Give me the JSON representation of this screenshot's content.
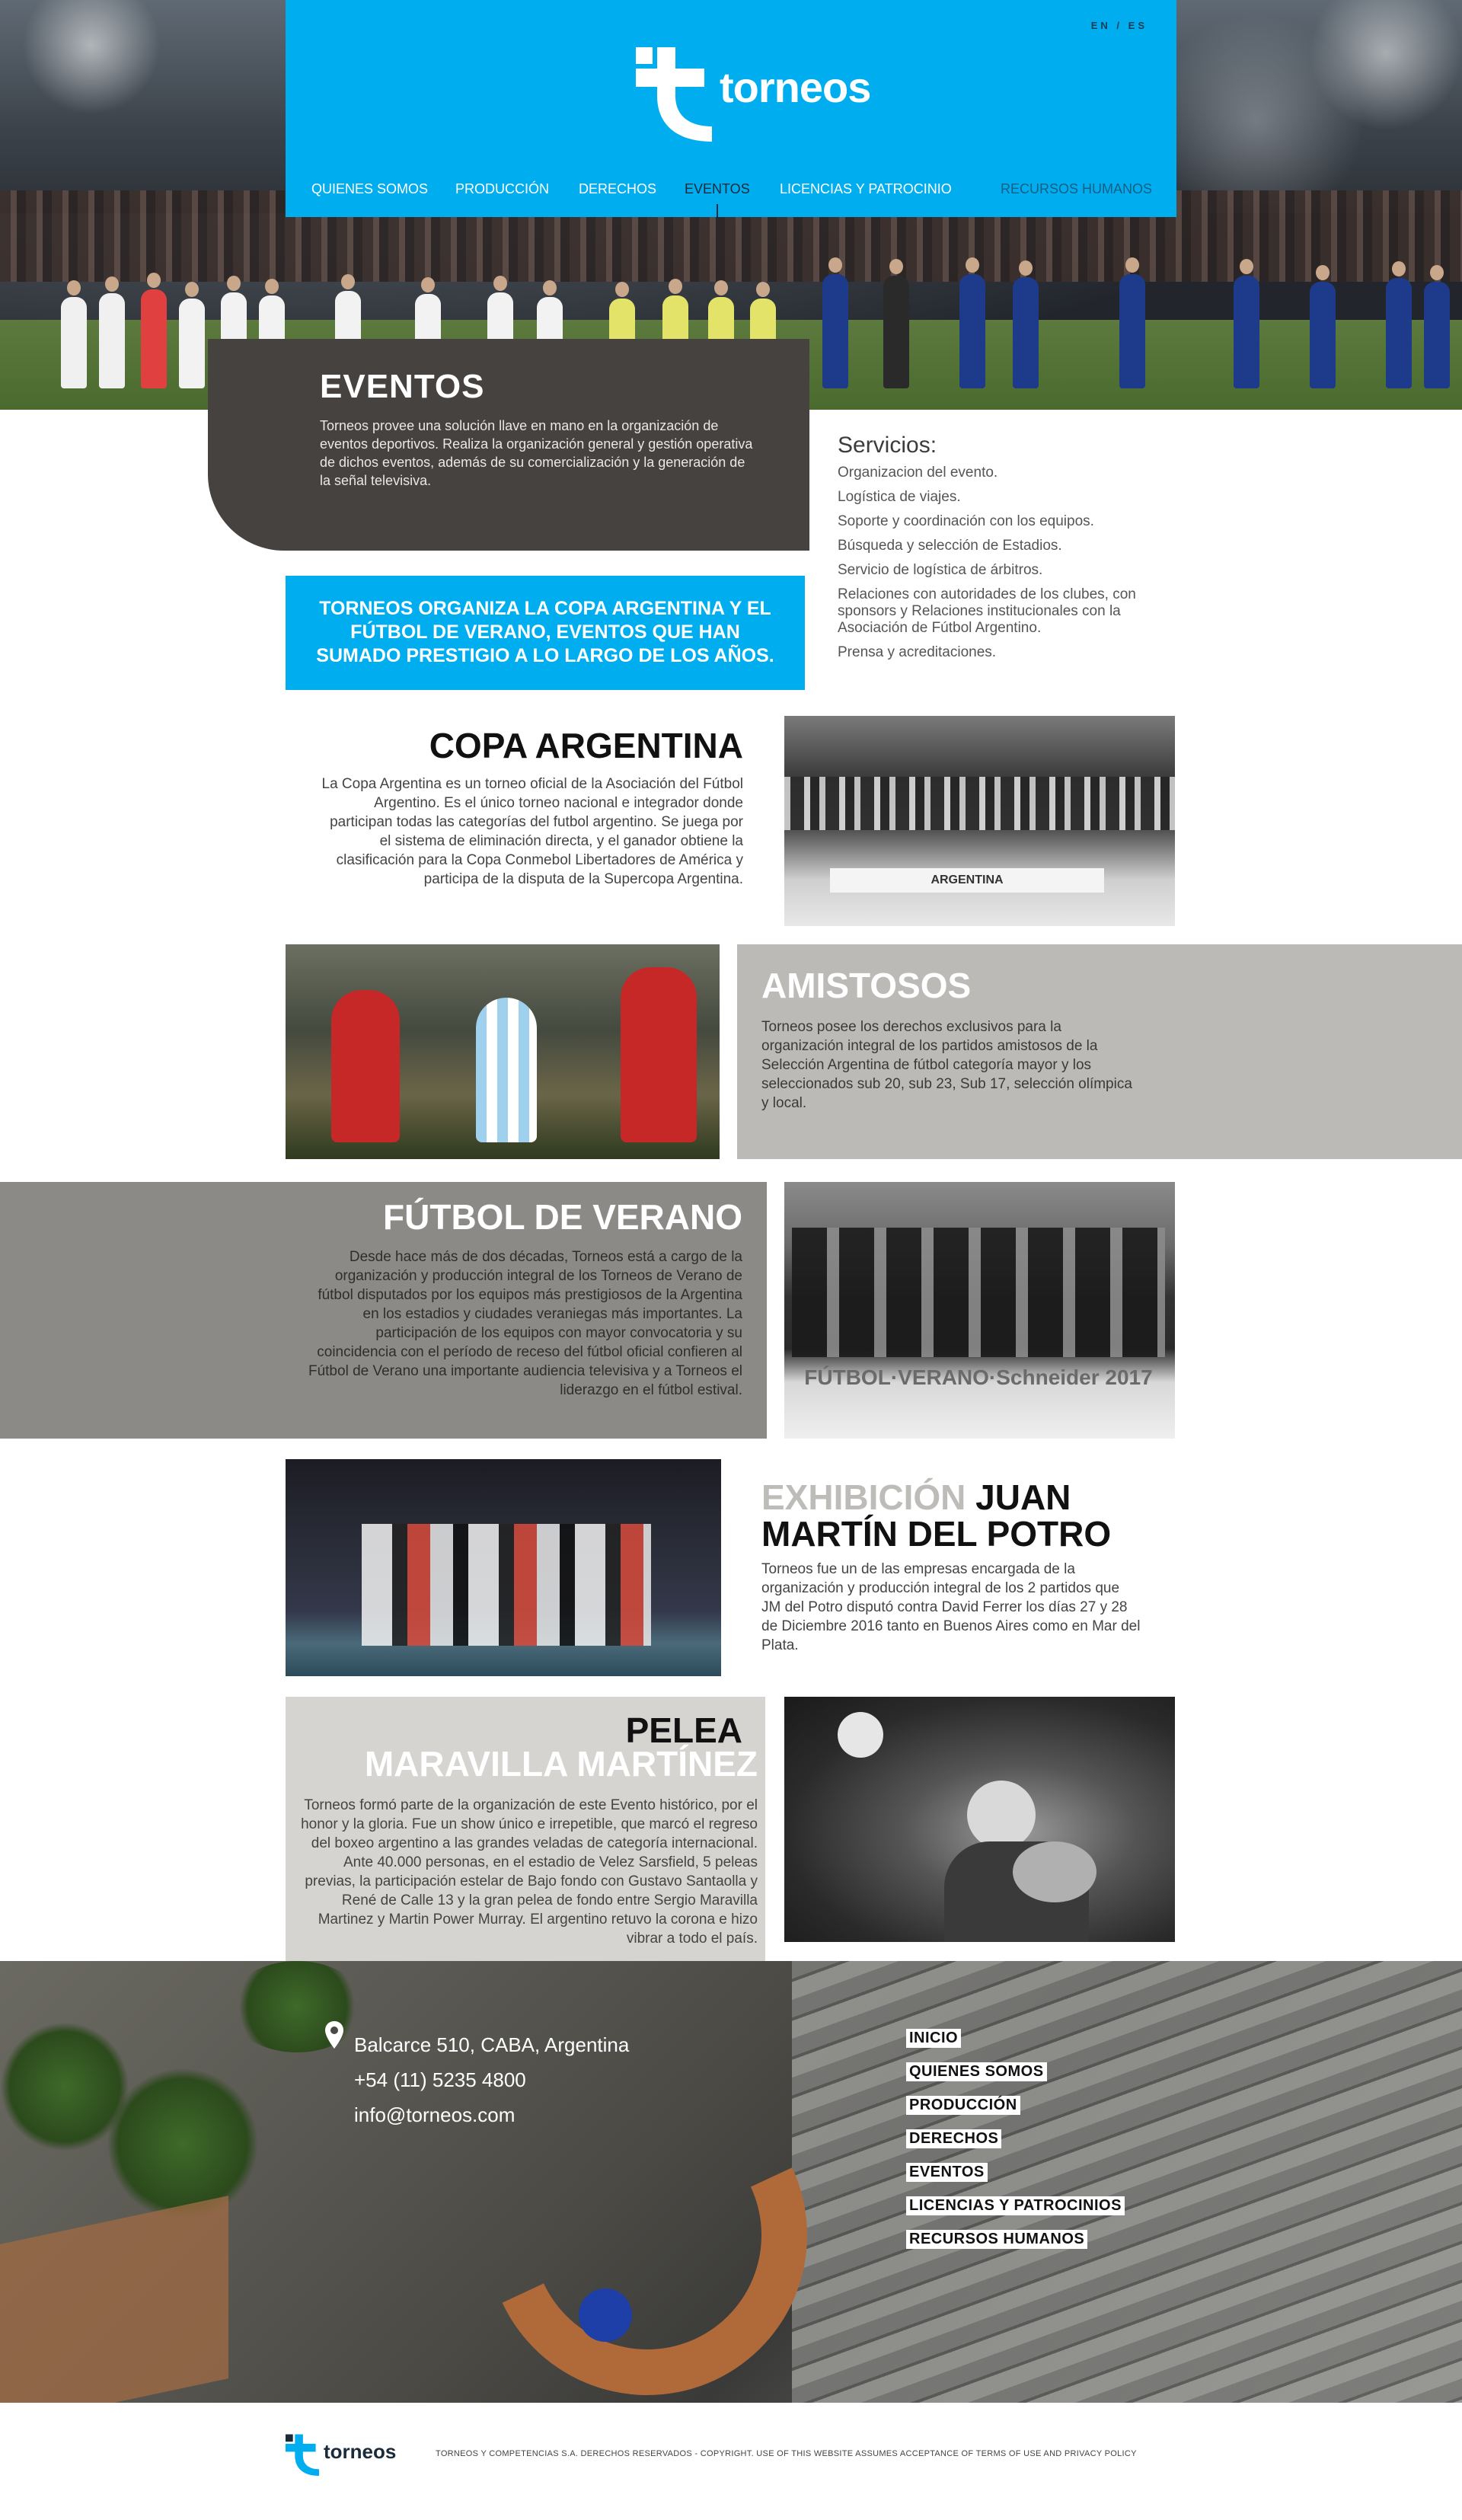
{
  "header": {
    "lang_switch": "EN / ES",
    "brand": "torneos",
    "nav": [
      {
        "label": "QUIENES SOMOS"
      },
      {
        "label": "PRODUCCIÓN"
      },
      {
        "label": "DERECHOS"
      },
      {
        "label": "EVENTOS"
      },
      {
        "label": "LICENCIAS Y PATROCINIO"
      },
      {
        "label": "RECURSOS HUMANOS"
      }
    ],
    "active_nav": "EVENTOS",
    "colors": {
      "brand_blue": "#00aeef",
      "dark": "#45423f"
    }
  },
  "intro": {
    "title": "EVENTOS",
    "text": "Torneos provee una solución llave en mano en la organización de eventos deportivos. Realiza la organización general y gestión operativa de dichos eventos, además de su comercialización y la generación de la señal televisiva."
  },
  "services": {
    "title": "Servicios:",
    "items": [
      "Organizacion del evento.",
      "Logística de viajes.",
      "Soporte y coordinación con los equipos.",
      "Búsqueda y selección de Estadios.",
      "Servicio de logística de árbitros.",
      "Relaciones con autoridades de los clubes, con sponsors y Relaciones institucionales con la Asociación de Fútbol Argentino.",
      "Prensa y acreditaciones."
    ]
  },
  "highlight": "TORNEOS ORGANIZA LA COPA ARGENTINA Y EL FÚTBOL DE VERANO, EVENTOS QUE HAN SUMADO PRESTIGIO A LO LARGO DE LOS AÑOS.",
  "sections": {
    "copa": {
      "title": "COPA ARGENTINA",
      "text": "La Copa Argentina es un torneo oficial de la  Asociación del Fútbol Argentino. Es el único torneo nacional e integrador donde participan todas las categorías del futbol argentino. Se juega por el sistema de eliminación directa, y el ganador obtiene la clasificación para la Copa Conmebol Libertadores de América y participa de la disputa de la Supercopa Argentina.",
      "photo_banner": "ARGENTINA"
    },
    "amistosos": {
      "title": "AMISTOSOS",
      "text": "Torneos posee los derechos exclusivos para la organización integral de los partidos amistosos de la Selección Argentina de fútbol categoría mayor y los seleccionados sub 20, sub 23, Sub 17, selección olímpica y local."
    },
    "verano": {
      "title": "FÚTBOL DE VERANO",
      "text": "Desde hace más de dos décadas, Torneos está a cargo de la organización y producción integral de los Torneos de Verano de fútbol disputados por los equipos más prestigiosos de la Argentina en los estadios y ciudades veraniegas más importantes. La participación de los equipos con mayor convocatoria y su coincidencia con el período de receso del fútbol oficial confieren al Fútbol de Verano una importante audiencia televisiva y a Torneos el liderazgo en el fútbol estival.",
      "photo_banner": "FÚTBOL·VERANO·Schneider 2017"
    },
    "delpotro": {
      "title_light": "EXHIBICIÓN",
      "title_dark_1": "JUAN",
      "title_dark_2": "MARTÍN DEL POTRO",
      "text": "Torneos fue un de las empresas encargada de la organización y producción integral de los 2 partidos que JM del Potro disputó contra David Ferrer los días 27 y 28 de Diciembre 2016 tanto en Buenos Aires como en Mar del Plata."
    },
    "pelea": {
      "title_1": "PELEA",
      "title_2": "MARAVILLA MARTÍNEZ",
      "text": "Torneos formó parte de la organización de este Evento histórico, por el honor y la gloria. Fue un show único e irrepetible, que marcó el regreso del boxeo argentino a las grandes veladas de categoría internacional. Ante 40.000 personas, en el estadio de Velez Sarsfield, 5 peleas previas, la participación estelar de Bajo fondo con Gustavo Santaolla y René de Calle 13 y la gran pelea de fondo entre Sergio Maravilla Martinez y Martin Power Murray. El argentino retuvo la corona e hizo vibrar a todo el país."
    }
  },
  "footer": {
    "address": "Balcarce 510, CABA, Argentina",
    "phone": "+54 (11) 5235 4800",
    "email": "info@torneos.com",
    "links": [
      "INICIO",
      "QUIENES SOMOS",
      "PRODUCCIÓN",
      "DERECHOS",
      "EVENTOS",
      "LICENCIAS Y PATROCINIOS",
      "RECURSOS HUMANOS"
    ],
    "brand": "torneos",
    "copyright": "TORNEOS Y COMPETENCIAS S.A. DERECHOS RESERVADOS - COPYRIGHT. USE OF THIS WEBSITE ASSUMES ACCEPTANCE OF TERMS OF USE AND PRIVACY POLICY"
  }
}
